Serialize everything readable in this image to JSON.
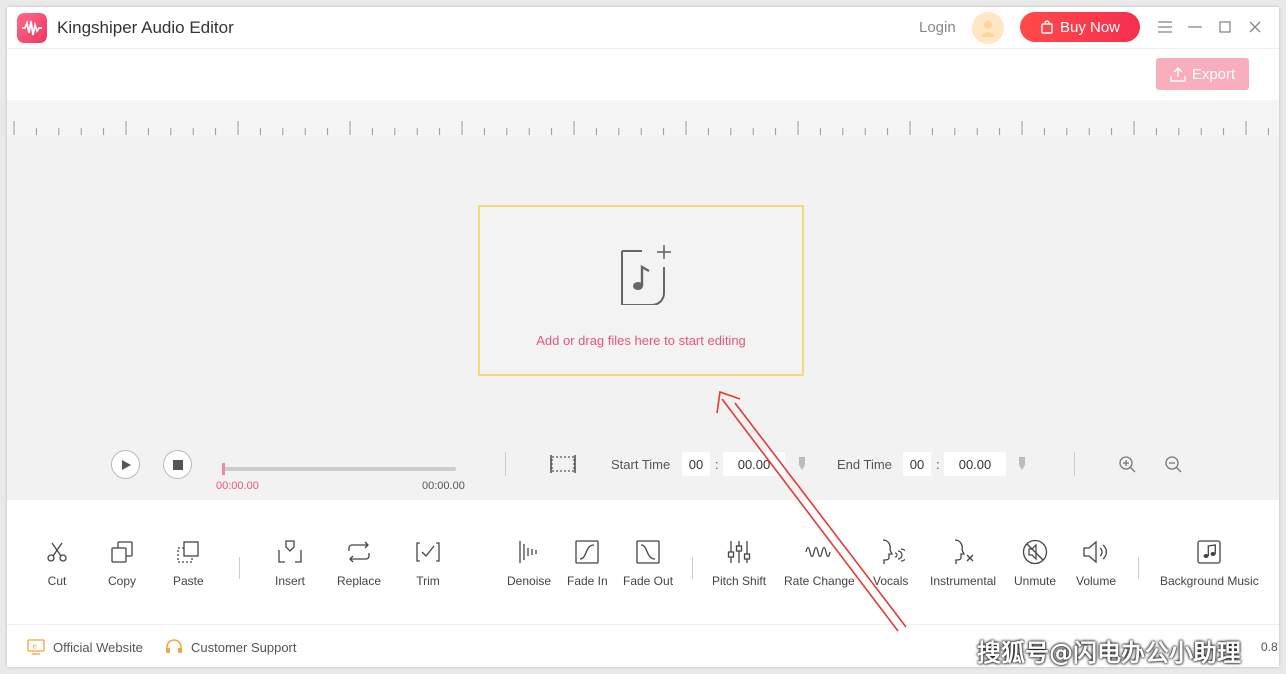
{
  "app": {
    "title": "Kingshiper Audio Editor"
  },
  "header": {
    "login_label": "Login",
    "buy_label": "Buy Now"
  },
  "toolbar": {
    "export_label": "Export"
  },
  "dropzone": {
    "text": "Add or drag files here to start editing"
  },
  "transport": {
    "current_time": "00:00.00",
    "total_time": "00:00.00",
    "start_label": "Start Time",
    "start_min": "00",
    "start_sec": "00.00",
    "end_label": "End Time",
    "end_min": "00",
    "end_sec": "00.00",
    "colon": ":"
  },
  "edit_tools": [
    {
      "label": "Cut",
      "icon": "scissors-icon"
    },
    {
      "label": "Copy",
      "icon": "copy-icon"
    },
    {
      "label": "Paste",
      "icon": "paste-icon"
    },
    {
      "label": "Insert",
      "icon": "insert-icon"
    },
    {
      "label": "Replace",
      "icon": "replace-icon"
    },
    {
      "label": "Trim",
      "icon": "trim-icon"
    }
  ],
  "effect_tools": [
    {
      "label": "Denoise",
      "icon": "denoise-icon"
    },
    {
      "label": "Fade In",
      "icon": "fade-in-icon"
    },
    {
      "label": "Fade Out",
      "icon": "fade-out-icon"
    },
    {
      "label": "Pitch Shift",
      "icon": "pitch-shift-icon"
    },
    {
      "label": "Rate Change",
      "icon": "rate-change-icon"
    },
    {
      "label": "Vocals",
      "icon": "vocals-icon"
    },
    {
      "label": "Instrumental",
      "icon": "instrumental-icon"
    },
    {
      "label": "Unmute",
      "icon": "unmute-icon"
    },
    {
      "label": "Volume",
      "icon": "volume-icon"
    },
    {
      "label": "Background Music",
      "icon": "background-music-icon"
    }
  ],
  "footer": {
    "website_label": "Official Website",
    "support_label": "Customer Support",
    "watermark": "搜狐号@闪电办公小助理",
    "version": "0.8"
  },
  "colors": {
    "accent": "#f2355f",
    "export_bg": "#f8aebc",
    "dropzone_border": "#f4d97a",
    "drop_text": "#e8557a"
  }
}
